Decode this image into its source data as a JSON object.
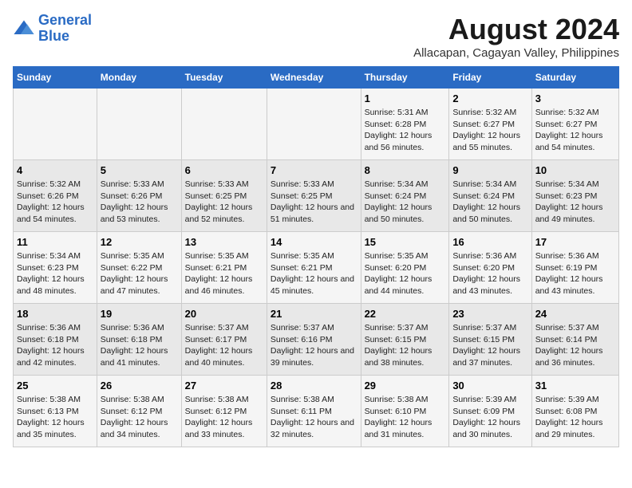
{
  "logo": {
    "line1": "General",
    "line2": "Blue"
  },
  "title": "August 2024",
  "subtitle": "Allacapan, Cagayan Valley, Philippines",
  "days_of_week": [
    "Sunday",
    "Monday",
    "Tuesday",
    "Wednesday",
    "Thursday",
    "Friday",
    "Saturday"
  ],
  "weeks": [
    [
      {
        "day": "",
        "info": ""
      },
      {
        "day": "",
        "info": ""
      },
      {
        "day": "",
        "info": ""
      },
      {
        "day": "",
        "info": ""
      },
      {
        "day": "1",
        "sunrise": "5:31 AM",
        "sunset": "6:28 PM",
        "daylight": "12 hours and 56 minutes."
      },
      {
        "day": "2",
        "sunrise": "5:32 AM",
        "sunset": "6:27 PM",
        "daylight": "12 hours and 55 minutes."
      },
      {
        "day": "3",
        "sunrise": "5:32 AM",
        "sunset": "6:27 PM",
        "daylight": "12 hours and 54 minutes."
      }
    ],
    [
      {
        "day": "4",
        "sunrise": "5:32 AM",
        "sunset": "6:26 PM",
        "daylight": "12 hours and 54 minutes."
      },
      {
        "day": "5",
        "sunrise": "5:33 AM",
        "sunset": "6:26 PM",
        "daylight": "12 hours and 53 minutes."
      },
      {
        "day": "6",
        "sunrise": "5:33 AM",
        "sunset": "6:25 PM",
        "daylight": "12 hours and 52 minutes."
      },
      {
        "day": "7",
        "sunrise": "5:33 AM",
        "sunset": "6:25 PM",
        "daylight": "12 hours and 51 minutes."
      },
      {
        "day": "8",
        "sunrise": "5:34 AM",
        "sunset": "6:24 PM",
        "daylight": "12 hours and 50 minutes."
      },
      {
        "day": "9",
        "sunrise": "5:34 AM",
        "sunset": "6:24 PM",
        "daylight": "12 hours and 50 minutes."
      },
      {
        "day": "10",
        "sunrise": "5:34 AM",
        "sunset": "6:23 PM",
        "daylight": "12 hours and 49 minutes."
      }
    ],
    [
      {
        "day": "11",
        "sunrise": "5:34 AM",
        "sunset": "6:23 PM",
        "daylight": "12 hours and 48 minutes."
      },
      {
        "day": "12",
        "sunrise": "5:35 AM",
        "sunset": "6:22 PM",
        "daylight": "12 hours and 47 minutes."
      },
      {
        "day": "13",
        "sunrise": "5:35 AM",
        "sunset": "6:21 PM",
        "daylight": "12 hours and 46 minutes."
      },
      {
        "day": "14",
        "sunrise": "5:35 AM",
        "sunset": "6:21 PM",
        "daylight": "12 hours and 45 minutes."
      },
      {
        "day": "15",
        "sunrise": "5:35 AM",
        "sunset": "6:20 PM",
        "daylight": "12 hours and 44 minutes."
      },
      {
        "day": "16",
        "sunrise": "5:36 AM",
        "sunset": "6:20 PM",
        "daylight": "12 hours and 43 minutes."
      },
      {
        "day": "17",
        "sunrise": "5:36 AM",
        "sunset": "6:19 PM",
        "daylight": "12 hours and 43 minutes."
      }
    ],
    [
      {
        "day": "18",
        "sunrise": "5:36 AM",
        "sunset": "6:18 PM",
        "daylight": "12 hours and 42 minutes."
      },
      {
        "day": "19",
        "sunrise": "5:36 AM",
        "sunset": "6:18 PM",
        "daylight": "12 hours and 41 minutes."
      },
      {
        "day": "20",
        "sunrise": "5:37 AM",
        "sunset": "6:17 PM",
        "daylight": "12 hours and 40 minutes."
      },
      {
        "day": "21",
        "sunrise": "5:37 AM",
        "sunset": "6:16 PM",
        "daylight": "12 hours and 39 minutes."
      },
      {
        "day": "22",
        "sunrise": "5:37 AM",
        "sunset": "6:15 PM",
        "daylight": "12 hours and 38 minutes."
      },
      {
        "day": "23",
        "sunrise": "5:37 AM",
        "sunset": "6:15 PM",
        "daylight": "12 hours and 37 minutes."
      },
      {
        "day": "24",
        "sunrise": "5:37 AM",
        "sunset": "6:14 PM",
        "daylight": "12 hours and 36 minutes."
      }
    ],
    [
      {
        "day": "25",
        "sunrise": "5:38 AM",
        "sunset": "6:13 PM",
        "daylight": "12 hours and 35 minutes."
      },
      {
        "day": "26",
        "sunrise": "5:38 AM",
        "sunset": "6:12 PM",
        "daylight": "12 hours and 34 minutes."
      },
      {
        "day": "27",
        "sunrise": "5:38 AM",
        "sunset": "6:12 PM",
        "daylight": "12 hours and 33 minutes."
      },
      {
        "day": "28",
        "sunrise": "5:38 AM",
        "sunset": "6:11 PM",
        "daylight": "12 hours and 32 minutes."
      },
      {
        "day": "29",
        "sunrise": "5:38 AM",
        "sunset": "6:10 PM",
        "daylight": "12 hours and 31 minutes."
      },
      {
        "day": "30",
        "sunrise": "5:39 AM",
        "sunset": "6:09 PM",
        "daylight": "12 hours and 30 minutes."
      },
      {
        "day": "31",
        "sunrise": "5:39 AM",
        "sunset": "6:08 PM",
        "daylight": "12 hours and 29 minutes."
      }
    ]
  ]
}
